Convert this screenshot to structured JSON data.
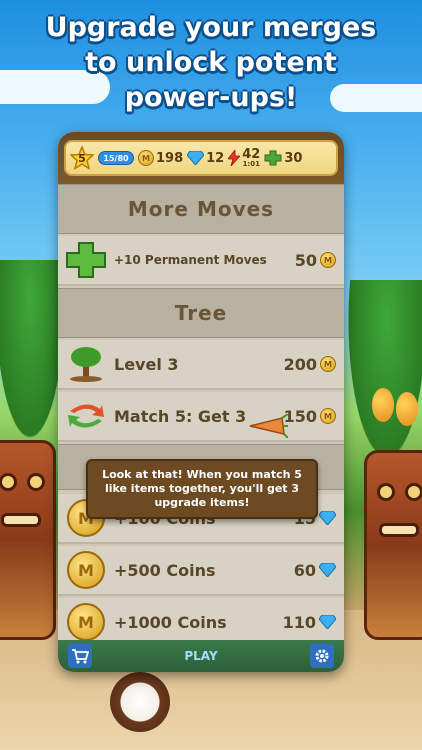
{
  "headline": {
    "line1": "Upgrade your merges",
    "line2": "to unlock potent",
    "line3": "power-ups!"
  },
  "statusbar": {
    "level": "5",
    "xp": "15/80",
    "coins": "198",
    "gems": "12",
    "energy": "42",
    "energy_timer": "1:01",
    "moves": "30"
  },
  "sections": {
    "more_moves": "More Moves",
    "tree": "Tree"
  },
  "rows": {
    "permanent_moves": {
      "label": "+10 Permanent Moves",
      "price": "50"
    },
    "tree_level": {
      "label": "Level 3",
      "price": "200"
    },
    "match5": {
      "label": "Match 5: Get 3",
      "price": "150"
    },
    "coins_100": {
      "label": "+100 Coins",
      "price": "15"
    },
    "coins_500": {
      "label": "+500 Coins",
      "price": "60"
    },
    "coins_1000": {
      "label": "+1000 Coins",
      "price": "110"
    }
  },
  "tooltip": {
    "text": "Look at that! When you match 5 like items together, you'll get 3 upgrade items!"
  },
  "bottombar": {
    "play": "PLAY"
  },
  "colors": {
    "coin": "#d49a18",
    "gem": "#3ab0f0",
    "panel": "#d8d2c4",
    "header_text": "#6a5536"
  },
  "icons": {
    "statusbar": [
      "star-icon",
      "coin-icon",
      "gem-icon",
      "lightning-icon",
      "moves-icon"
    ],
    "rows": [
      "moves-icon",
      "tree-icon",
      "swap-arrows-icon",
      "coin-icon"
    ],
    "bottombar": [
      "cart-icon",
      "gear-icon"
    ]
  }
}
